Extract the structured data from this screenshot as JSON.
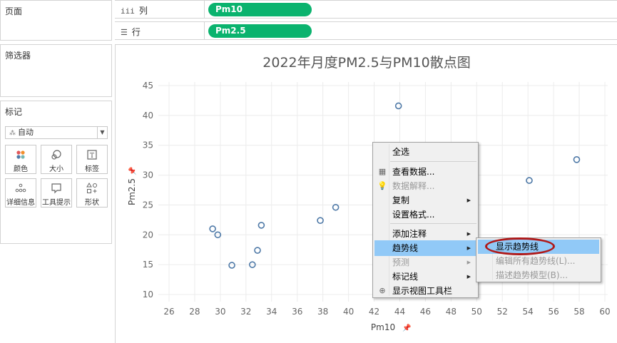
{
  "pages_panel": {
    "title": "页面"
  },
  "filters_panel": {
    "title": "筛选器"
  },
  "marks_panel": {
    "title": "标记",
    "mark_type": "自动",
    "buttons": [
      {
        "label": "颜色",
        "icon": "color-dots-icon"
      },
      {
        "label": "大小",
        "icon": "size-icon"
      },
      {
        "label": "标签",
        "icon": "label-icon"
      },
      {
        "label": "详细信息",
        "icon": "detail-dots-icon"
      },
      {
        "label": "工具提示",
        "icon": "tooltip-icon"
      },
      {
        "label": "形状",
        "icon": "shape-icon"
      }
    ]
  },
  "shelves": {
    "columns": {
      "label": "列",
      "glyph": "iii",
      "pill": "Pm10",
      "pill_color": "#0ab36e"
    },
    "rows": {
      "label": "行",
      "glyph": "☰",
      "pill": "Pm2.5",
      "pill_color": "#0ab36e"
    }
  },
  "chart_data": {
    "type": "scatter",
    "title": "2022年月度PM2.5与PM10散点图",
    "xlabel": "Pm10",
    "ylabel": "Pm2.5",
    "xlim": [
      24.5,
      60.5
    ],
    "ylim": [
      8.5,
      46
    ],
    "xticks": [
      "26",
      "28",
      "30",
      "32",
      "34",
      "36",
      "38",
      "40",
      "42",
      "44",
      "46",
      "48",
      "50",
      "52",
      "54",
      "56",
      "58",
      "60"
    ],
    "yticks": [
      "10",
      "15",
      "20",
      "25",
      "30",
      "35",
      "40",
      "45"
    ],
    "grid": true,
    "marker": "hollow-circle",
    "marker_color": "#4e79a7",
    "points": [
      {
        "x": 29.4,
        "y": 21.0
      },
      {
        "x": 29.8,
        "y": 20.0
      },
      {
        "x": 30.9,
        "y": 14.9
      },
      {
        "x": 32.5,
        "y": 15.0
      },
      {
        "x": 32.9,
        "y": 17.4
      },
      {
        "x": 33.2,
        "y": 21.6
      },
      {
        "x": 37.8,
        "y": 22.4
      },
      {
        "x": 39.0,
        "y": 24.6
      },
      {
        "x": 43.9,
        "y": 41.6
      },
      {
        "x": 54.1,
        "y": 29.1
      },
      {
        "x": 57.8,
        "y": 32.6
      }
    ]
  },
  "context_menu": {
    "items": [
      {
        "label": "全选",
        "state": "normal",
        "submenu": false,
        "lead": ""
      },
      {
        "label": "查看数据...",
        "state": "normal",
        "submenu": false,
        "lead": "▦"
      },
      {
        "label": "数据解释...",
        "state": "disabled",
        "submenu": false,
        "lead": "💡"
      },
      {
        "label": "复制",
        "state": "normal",
        "submenu": true,
        "lead": ""
      },
      {
        "label": "设置格式...",
        "state": "normal",
        "submenu": false,
        "lead": ""
      },
      {
        "label": "添加注释",
        "state": "normal",
        "submenu": true,
        "lead": ""
      },
      {
        "label": "趋势线",
        "state": "highlighted",
        "submenu": true,
        "lead": ""
      },
      {
        "label": "预测",
        "state": "disabled",
        "submenu": true,
        "lead": ""
      },
      {
        "label": "标记线",
        "state": "normal",
        "submenu": true,
        "lead": ""
      },
      {
        "label": "显示视图工具栏",
        "state": "normal",
        "submenu": false,
        "lead": "⊕"
      }
    ]
  },
  "trend_submenu": {
    "items": [
      {
        "label": "显示趋势线",
        "state": "highlighted"
      },
      {
        "label": "编辑所有趋势线(L)...",
        "state": "disabled"
      },
      {
        "label": "描述趋势模型(B)...",
        "state": "disabled"
      }
    ],
    "annotation_color": "#b01919"
  },
  "colors": {
    "grid": "#ececec",
    "axis_text": "#666666",
    "highlight": "#91c9f7"
  }
}
